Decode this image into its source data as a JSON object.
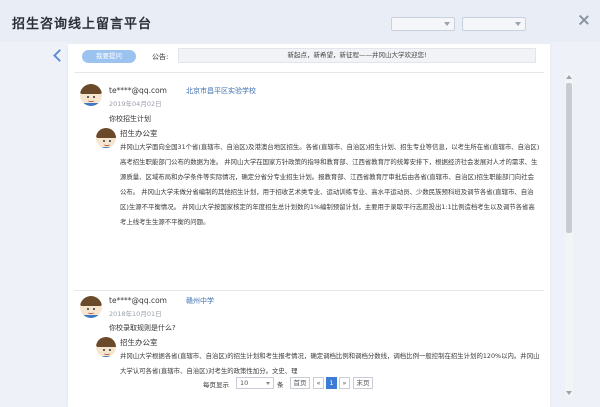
{
  "app": {
    "title": "招生咨询线上留言平台"
  },
  "filters": {
    "select1": "",
    "select2": ""
  },
  "toolbar": {
    "ask_label": "我要提问",
    "notice_label": "公告:",
    "notice_text": "新起点，新希望，新征程——井冈山大学欢迎您!"
  },
  "messages": [
    {
      "user": "te****@qq.com",
      "org": "北京市昌平区实验学校",
      "date": "2019年04月02日",
      "question": "你校招生计划",
      "reply_from": "招生办公室",
      "reply_text": "井冈山大学面向全国31个省(直辖市、自治区)及港澳台地区招生。各省(直辖市、自治区)招生计划、招生专业等信息，以考生所在省(直辖市、自治区)高考招生职能部门公布的数据为准。    井冈山大学在国家方针政策的指导和教育部、江西省教育厅的统筹安排下，根据经济社会发展对人才的需求、生源质量、区域布局和办学条件等实际情况，确定分省分专业招生计划。报教育部、江西省教育厅审批后由各省(直辖市、自治区)招生职能部门向社会公布。      井冈山大学未做分省编制的其他招生计划，用于招收艺术类专业、运动训练专业、高水平运动员、少数民族预科班及调节各省(直辖市、自治区)生源不平衡情况。      井冈山大学按国家核定的年度招生总计划数的1%编制预留计划，主要用于录取平行志愿投出1:1比例造档考生以及调节各省高考上线考生生源不平衡的问题。"
    },
    {
      "user": "te****@qq.com",
      "org": "赣州中学",
      "date": "2018年10月01日",
      "question": "你校录取规则是什么?",
      "reply_from": "招生办公室",
      "reply_text": "井冈山大学根据各省(直辖市、自治区)的招生计划和考生报考情况，确定调档比例和调档分数线，调档比例一般控制在招生计划的120%以内。井冈山大学认可各省(直辖市、自治区)对考生的政策性加分。文史、理"
    }
  ],
  "pager": {
    "per_page_label": "每页显示",
    "per_page_value": "10",
    "unit": "条",
    "first": "首页",
    "prev": "«",
    "current": "1",
    "next": "»",
    "last": "末页"
  },
  "colors": {
    "accent": "#3c7cd6",
    "button": "#9cc3f0",
    "org_link": "#3e6fb0"
  },
  "icons": {
    "back": "chevron-left-icon",
    "close": "close-icon",
    "avatar": "user-avatar"
  }
}
